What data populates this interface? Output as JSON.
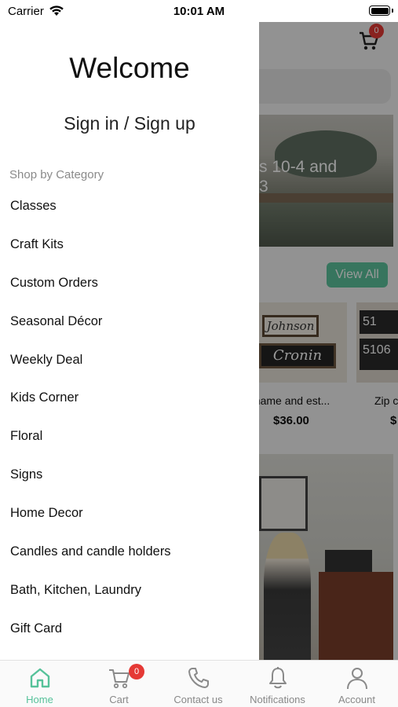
{
  "status_bar": {
    "carrier": "Carrier",
    "time": "10:01 AM"
  },
  "drawer": {
    "welcome": "Welcome",
    "signin_label": "Sign in / Sign up",
    "category_header": "Shop by Category",
    "categories": [
      "Classes",
      "Craft Kits",
      "Custom Orders",
      "Seasonal Décor",
      "Weekly Deal",
      "Kids Corner",
      "Floral",
      "Signs",
      "Home Decor",
      "Candles and candle holders",
      "Bath, Kitchen, Laundry",
      "Gift Card"
    ]
  },
  "background": {
    "cart_count": "0",
    "banner_text": "s 10-4 and",
    "banner_text_2": "3",
    "view_all_label": "View All",
    "products": [
      {
        "name": "t name and est...",
        "price": "$36.00",
        "sign_top": "Johnson",
        "sign_bottom": "Cronin"
      },
      {
        "name": "Zip c",
        "price": "$",
        "sign_top": "51",
        "sign_bottom": "5106"
      }
    ]
  },
  "tabbar": {
    "tabs": [
      {
        "label": "Home",
        "icon": "home-icon",
        "active": true
      },
      {
        "label": "Cart",
        "icon": "cart-icon",
        "badge": "0"
      },
      {
        "label": "Contact us",
        "icon": "phone-icon"
      },
      {
        "label": "Notifications",
        "icon": "bell-icon"
      },
      {
        "label": "Account",
        "icon": "person-icon"
      }
    ]
  },
  "colors": {
    "accent": "#56c29a",
    "badge": "#e53935",
    "view_all_bg": "#5cc49d"
  }
}
